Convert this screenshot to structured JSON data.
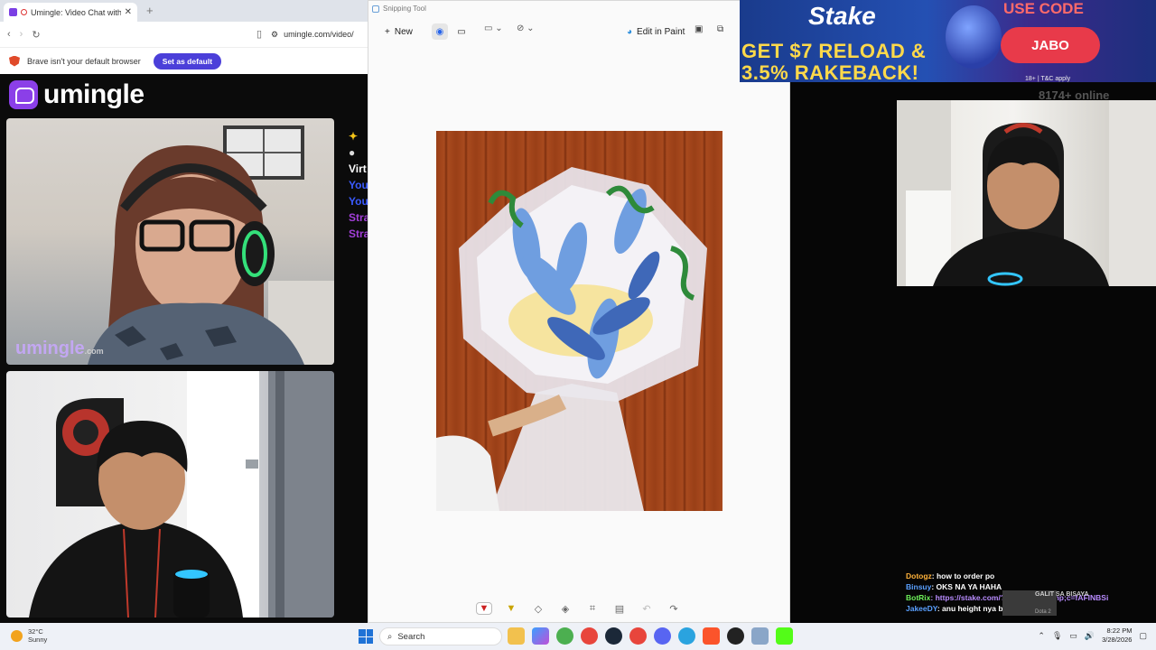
{
  "browser": {
    "tab_title": "Umingle: Video Chat with Str",
    "url": "umingle.com/video/",
    "infobar_text": "Brave isn't your default browser",
    "infobar_button": "Set as default"
  },
  "site": {
    "name": "umingle",
    "watermark": "umingle",
    "watermark_suffix": ".com",
    "chat_fragments": [
      {
        "text": "Virt",
        "color": "#ffffff"
      },
      {
        "text": "You",
        "color": "#3b5bff"
      },
      {
        "text": "You",
        "color": "#3b5bff"
      },
      {
        "text": "Stra",
        "color": "#a23fd8"
      },
      {
        "text": "Stra",
        "color": "#a23fd8"
      }
    ],
    "sparkle_icon": "sparkle-icon"
  },
  "snipping_tool": {
    "title": "Snipping Tool",
    "new_label": "New",
    "edit_in_paint": "Edit in Paint"
  },
  "ad": {
    "brand": "Stake",
    "offer_line1": "GET $7 RELOAD &",
    "offer_line2": "3.5% RAKEBACK!",
    "use_code": "USE CODE",
    "code": "JABO",
    "fine_print": "18+ | T&C apply"
  },
  "online_count": "8174+ online",
  "stream_chat": [
    {
      "user": "Dotogz",
      "user_color": "#ffb23a",
      "message": ": how to order po",
      "msg_color": "#ffffff"
    },
    {
      "user": "Binsuy",
      "user_color": "#5aa0ff",
      "message": ": OKS NA YA HAHA",
      "msg_color": "#ffffff"
    },
    {
      "user": "BotRix",
      "user_color": "#6df05a",
      "message": ": https://stake.com/?offer=jabo&amp;c=fAFINBSi",
      "msg_color": "#b98cff"
    },
    {
      "user": "JakeeDY",
      "user_color": "#5aa0ff",
      "message": ": anu height nya bo?",
      "msg_color": "#ffffff"
    }
  ],
  "stream_overlay": {
    "title": "GALIT SA BISAYA",
    "subtitle": "Dota 2"
  },
  "taskbar": {
    "temperature": "32°C",
    "condition": "Sunny",
    "search_label": "Search",
    "time": "8:22 PM",
    "date": "3/28/2026"
  }
}
